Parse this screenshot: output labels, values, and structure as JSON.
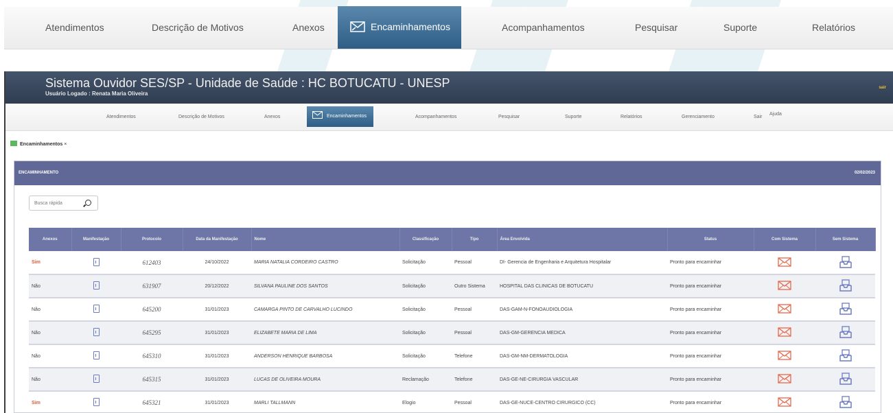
{
  "top_nav": {
    "items": [
      "Atendimentos",
      "Descrição de Motivos",
      "Anexos",
      "Encaminhamentos",
      "Acompanhamentos",
      "Pesquisar",
      "Suporte",
      "Relatórios"
    ],
    "active": "Encaminhamentos"
  },
  "header": {
    "title": "Sistema Ouvidor SES/SP - Unidade de Saúde : HC BOTUCATU - UNESP",
    "user": "Usuário Logado : Renata Maria Oliveira",
    "corner": "sair"
  },
  "sub_nav": {
    "items": [
      "Atendimentos",
      "Descrição de Motivos",
      "Anexos",
      "Encaminhamentos",
      "Acompanhamentos",
      "Pesquisar",
      "Suporte",
      "Relatórios",
      "Gerenciamento",
      "Sair",
      "Ajuda"
    ]
  },
  "tab": {
    "label": "Encaminhamentos",
    "close": "×"
  },
  "panel": {
    "title": "ENCAMINHAMENTO",
    "date": "02/02/2023"
  },
  "search": {
    "placeholder": "Busca rápida"
  },
  "table": {
    "headers": [
      "Anexos",
      "Manifestação",
      "Protocolo",
      "Data da Manifestação",
      "Nome",
      "Classificação",
      "Tipo",
      "Área Envolvida",
      "Status",
      "Com Sistema",
      "Sem Sistema"
    ],
    "rows": [
      {
        "anexos": "Sim",
        "protocolo": "612403",
        "data": "24/10/2022",
        "nome": "MARIA NATALIA CORDEIRO CASTRO",
        "classificacao": "Solicitação",
        "tipo": "Pessoal",
        "area": "DI- Gerencia de Engenharia e Arquitetura Hospitalar",
        "status": "Pronto para encaminhar"
      },
      {
        "anexos": "Não",
        "protocolo": "631907",
        "data": "20/12/2022",
        "nome": "SILVANA PAULINE DOS SANTOS",
        "classificacao": "Solicitação",
        "tipo": "Outro Sistema",
        "area": "HOSPITAL DAS CLINICAS DE BOTUCATU",
        "status": "Pronto para encaminhar"
      },
      {
        "anexos": "Não",
        "protocolo": "645200",
        "data": "31/01/2023",
        "nome": "CAMARGA PINTO DE CARVALHO LUCINDO",
        "classificacao": "Solicitação",
        "tipo": "Pessoal",
        "area": "DAS-GAM-N-FONOAUDIOLOGIA",
        "status": "Pronto para encaminhar"
      },
      {
        "anexos": "Não",
        "protocolo": "645295",
        "data": "31/01/2023",
        "nome": "ELIZABETE MARIA DE LIMA",
        "classificacao": "Solicitação",
        "tipo": "Pessoal",
        "area": "DAS-GM-GERENCIA MEDICA",
        "status": "Pronto para encaminhar"
      },
      {
        "anexos": "Não",
        "protocolo": "645310",
        "data": "31/01/2023",
        "nome": "ANDERSON HENRIQUE BARBOSA",
        "classificacao": "Solicitação",
        "tipo": "Telefone",
        "area": "DAS-GM-NM-DERMATOLOGIA",
        "status": "Pronto para encaminhar"
      },
      {
        "anexos": "Não",
        "protocolo": "645315",
        "data": "31/01/2023",
        "nome": "LUCAS DE OLIVEIRA MOURA",
        "classificacao": "Reclamação",
        "tipo": "Telefone",
        "area": "DAS-GE-NE-CIRURGIA VASCULAR",
        "status": "Pronto para encaminhar"
      },
      {
        "anexos": "Sim",
        "protocolo": "645321",
        "data": "31/01/2023",
        "nome": "MARLI TALLMANN",
        "classificacao": "Elogio",
        "tipo": "Pessoal",
        "area": "DAS-GE-NUCE-CENTRO CIRURGICO (CC)",
        "status": "Pronto para encaminhar"
      }
    ]
  },
  "colors": {
    "accent": "#2e5d85",
    "header": "#2f3d52",
    "panel": "#5f6896",
    "sim": "#e05c3a",
    "mail": "#e7674a",
    "cloud": "#6c7bc6"
  }
}
